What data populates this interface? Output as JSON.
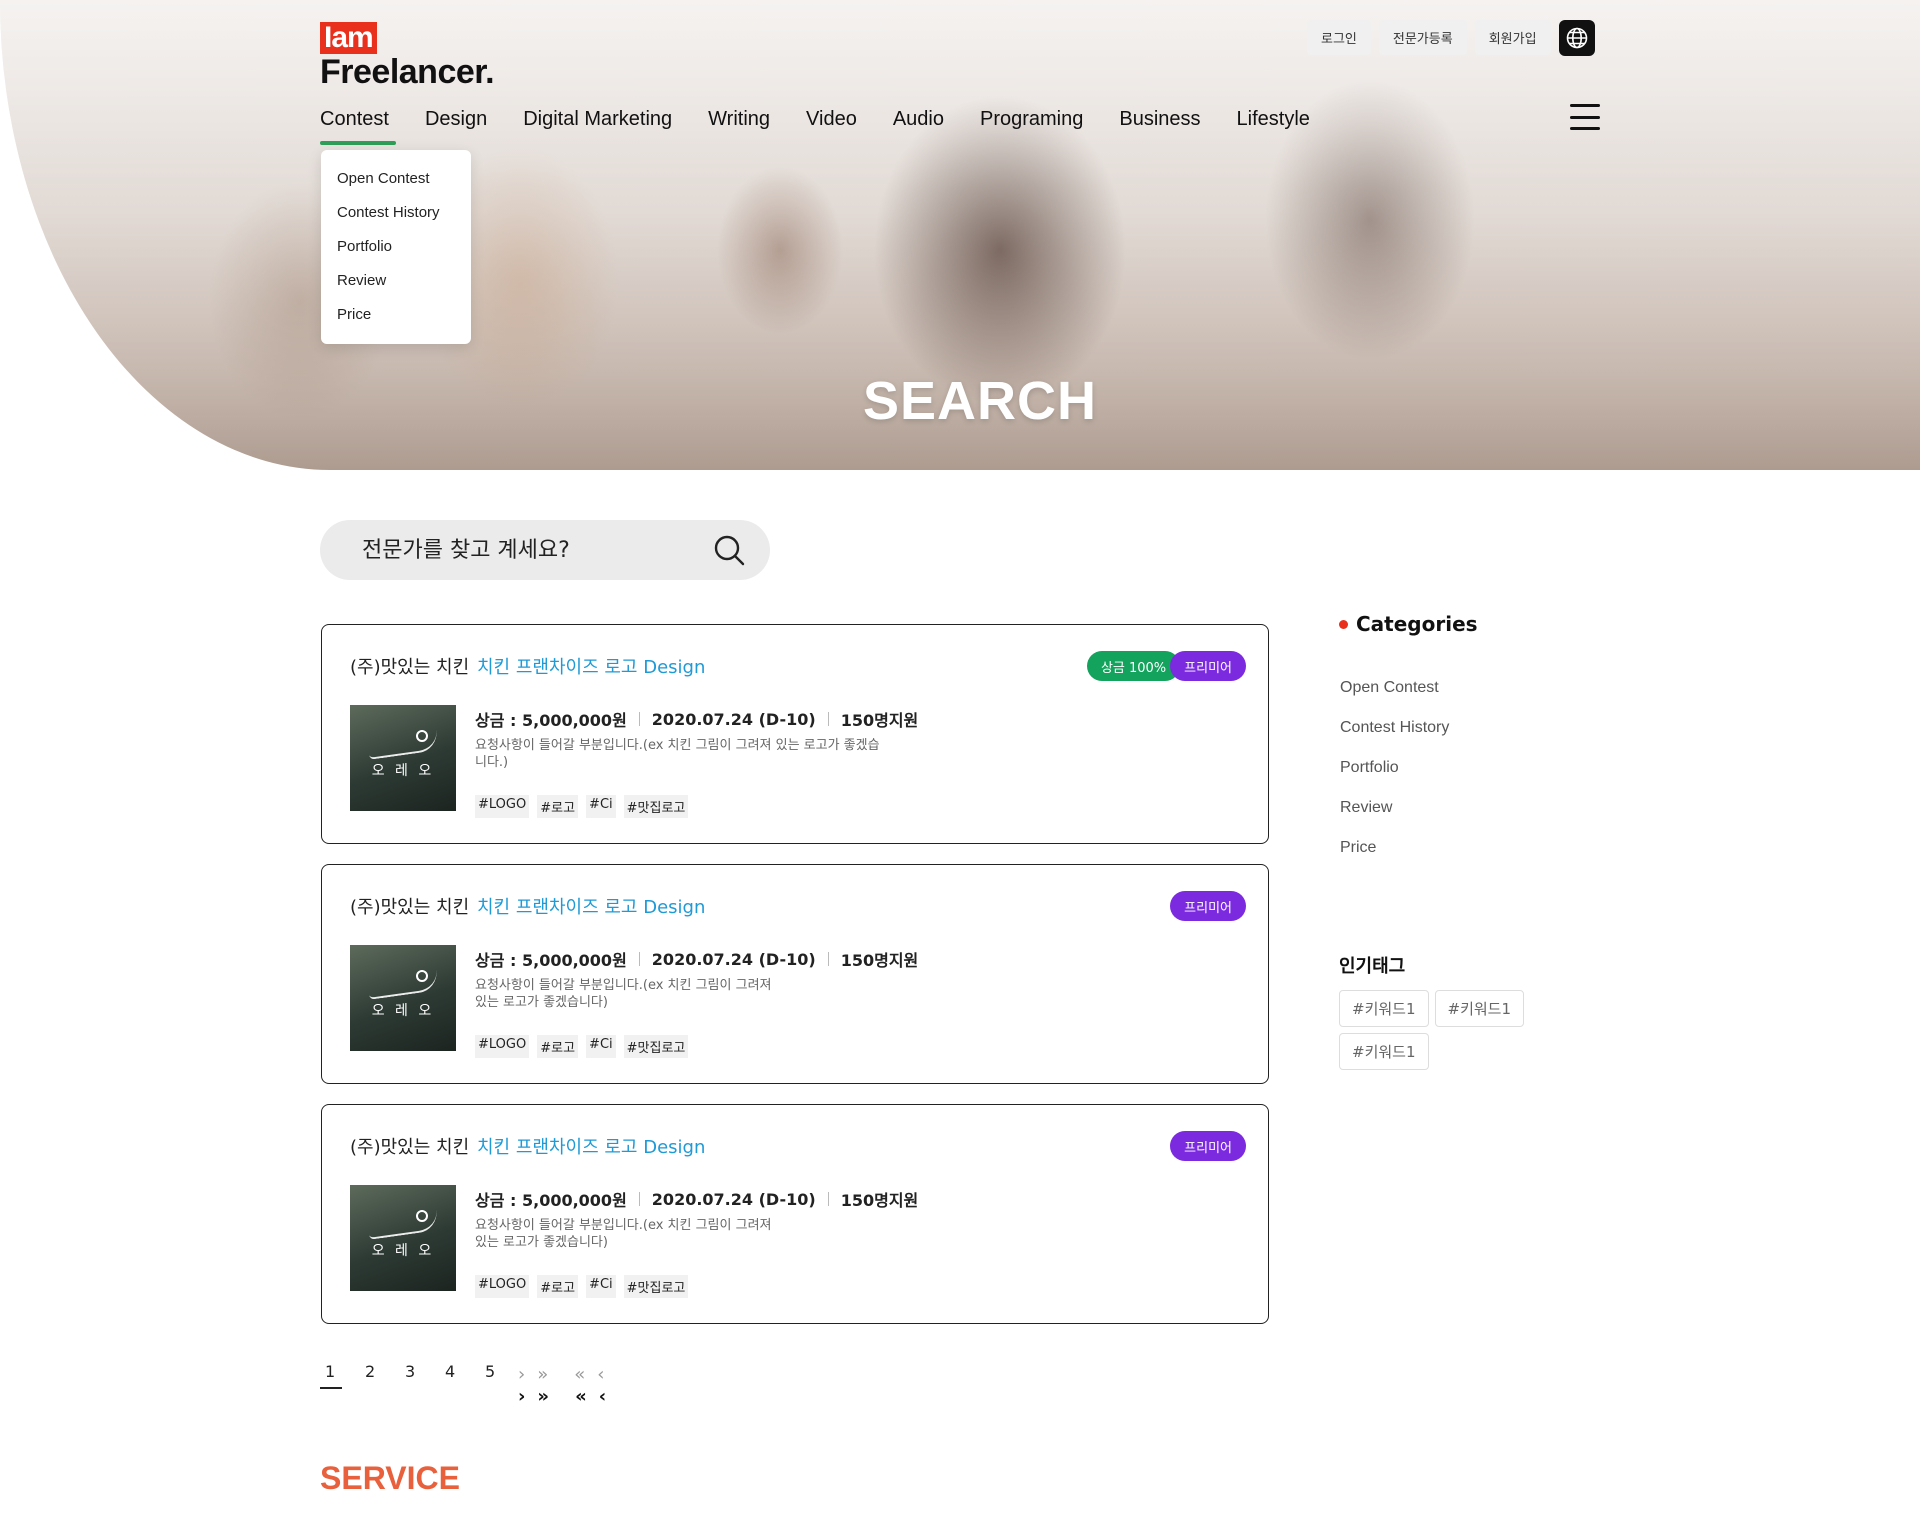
{
  "logo": {
    "top": "Iam",
    "bottom": "Freelancer."
  },
  "top_buttons": {
    "login": "로그인",
    "expert_register": "전문가등록",
    "signup": "회원가입"
  },
  "nav": {
    "items": [
      "Contest",
      "Design",
      "Digital Marketing",
      "Writing",
      "Video",
      "Audio",
      "Programing",
      "Business",
      "Lifestyle"
    ],
    "active": "Contest",
    "dropdown": [
      "Open Contest",
      "Contest History",
      "Portfolio",
      "Review",
      "Price"
    ]
  },
  "hero": {
    "title": "SEARCH"
  },
  "search": {
    "placeholder": "전문가를 찾고 계세요?"
  },
  "cards": [
    {
      "company": "(주)맛있는 치킨",
      "title": "치킨 프랜차이즈 로고 Design",
      "badges": [
        {
          "label": "상금 100%",
          "color": "#13a35c"
        },
        {
          "label": "프리미어",
          "color": "#7b2ae0"
        }
      ],
      "thumb_text": "오 레 오",
      "prize": "상금 : 5,000,000원",
      "date": "2020.07.24 (D-10)",
      "applicants": "150명지원",
      "desc_line1": "요청사항이 들어갈 부분입니다.(ex 치킨 그림이 그려져 있는 로고가 좋겠습",
      "desc_line2": "니다.)",
      "tags": [
        "#LOGO",
        "#로고",
        "#Ci",
        "#맛집로고"
      ]
    },
    {
      "company": "(주)맛있는 치킨",
      "title": "치킨 프랜차이즈 로고 Design",
      "badges": [
        {
          "label": "프리미어",
          "color": "#7b2ae0"
        }
      ],
      "thumb_text": "오 레 오",
      "prize": "상금 : 5,000,000원",
      "date": "2020.07.24 (D-10)",
      "applicants": "150명지원",
      "desc_line1": "요청사항이 들어갈 부분입니다.(ex 치킨 그림이 그려져",
      "desc_line2": "있는 로고가 좋겠습니다)",
      "tags": [
        "#LOGO",
        "#로고",
        "#Ci",
        "#맛집로고"
      ]
    },
    {
      "company": "(주)맛있는 치킨",
      "title": "치킨 프랜차이즈 로고 Design",
      "badges": [
        {
          "label": "프리미어",
          "color": "#7b2ae0"
        }
      ],
      "thumb_text": "오 레 오",
      "prize": "상금 : 5,000,000원",
      "date": "2020.07.24 (D-10)",
      "applicants": "150명지원",
      "desc_line1": "요청사항이 들어갈 부분입니다.(ex 치킨 그림이 그려져",
      "desc_line2": "있는 로고가 좋겠습니다)",
      "tags": [
        "#LOGO",
        "#로고",
        "#Ci",
        "#맛집로고"
      ]
    }
  ],
  "sidebar": {
    "categories_title": "Categories",
    "categories": [
      "Open Contest",
      "Contest History",
      "Portfolio",
      "Review",
      "Price"
    ],
    "popular_title": "인기태그",
    "popular_tags": [
      "#키워드1",
      "#키워드1",
      "#키워드1"
    ]
  },
  "pagination": {
    "pages": [
      "1",
      "2",
      "3",
      "4",
      "5"
    ],
    "active": "1",
    "next": "›",
    "last": "»",
    "first": "«",
    "prev": "‹"
  },
  "footer": {
    "service_title": "SERVICE"
  },
  "colors": {
    "brand_red": "#e8301c",
    "accent_green": "#2f9e58",
    "link_blue": "#1f9ad6",
    "premier_purple": "#7b2ae0",
    "prize_green": "#13a35c",
    "service_orange": "#e8603c"
  }
}
